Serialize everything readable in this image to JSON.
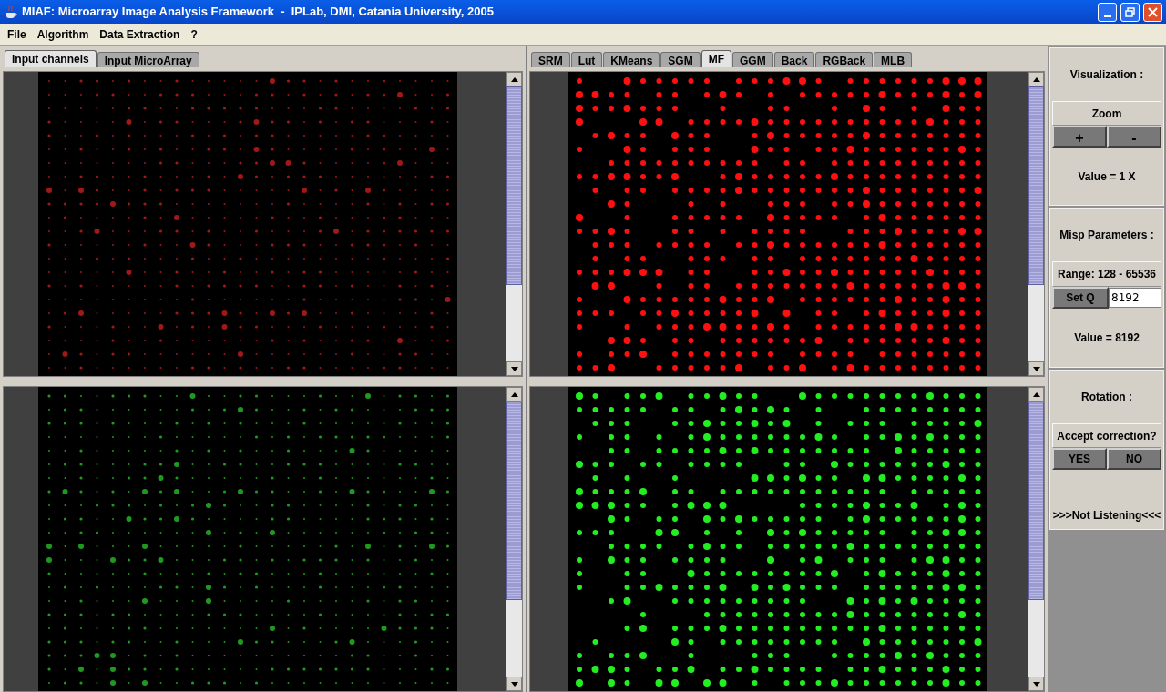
{
  "window": {
    "title": "MIAF: Microarray Image Analysis Framework  -  IPLab, DMI, Catania University, 2005"
  },
  "menu": [
    "File",
    "Algorithm",
    "Data Extraction",
    "?"
  ],
  "left_tabs": [
    {
      "label": "Input channels",
      "selected": true
    },
    {
      "label": "Input MicroArray",
      "selected": false
    }
  ],
  "right_tabs": [
    {
      "label": "SRM",
      "selected": false
    },
    {
      "label": "Lut",
      "selected": false
    },
    {
      "label": "KMeans",
      "selected": false
    },
    {
      "label": "SGM",
      "selected": false
    },
    {
      "label": "MF",
      "selected": true
    },
    {
      "label": "GGM",
      "selected": false
    },
    {
      "label": "Back",
      "selected": false
    },
    {
      "label": "RGBack",
      "selected": false
    },
    {
      "label": "MLB",
      "selected": false
    }
  ],
  "left_images": [
    {
      "color": "#a01818"
    },
    {
      "color": "#1f9a1f"
    }
  ],
  "right_images": [
    {
      "color": "#ff1010"
    },
    {
      "color": "#22ee22"
    }
  ],
  "visualization": {
    "heading": "Visualization :",
    "zoom_label": "Zoom",
    "buttons": [
      "+",
      "-"
    ],
    "value": "Value = 1 X"
  },
  "misp": {
    "heading": "Misp Parameters :",
    "range": "Range: 128 - 65536",
    "button": "Set Q",
    "field_value": "8192",
    "value": "Value = 8192"
  },
  "rotation": {
    "heading": "Rotation :",
    "prompt": "Accept correction?",
    "buttons": [
      "YES",
      "NO"
    ],
    "status": ">>>Not Listening<<<"
  }
}
